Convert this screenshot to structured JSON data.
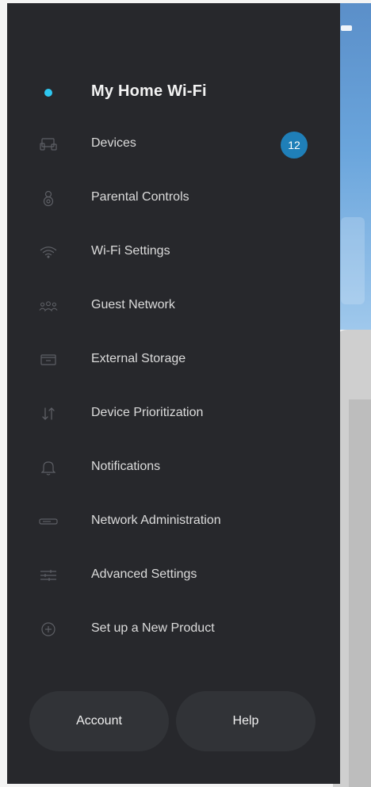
{
  "drawer": {
    "network_name": "My Home Wi-Fi",
    "status_color": "#2ec7f0",
    "items": [
      {
        "label": "Devices",
        "icon": "devices-icon",
        "badge": "12"
      },
      {
        "label": "Parental Controls",
        "icon": "parental-controls-icon"
      },
      {
        "label": "Wi-Fi Settings",
        "icon": "wifi-icon"
      },
      {
        "label": "Guest Network",
        "icon": "guests-icon"
      },
      {
        "label": "External Storage",
        "icon": "storage-icon"
      },
      {
        "label": "Device Prioritization",
        "icon": "prioritization-arrows-icon"
      },
      {
        "label": "Notifications",
        "icon": "bell-icon"
      },
      {
        "label": "Network Administration",
        "icon": "router-icon"
      },
      {
        "label": "Advanced Settings",
        "icon": "sliders-icon"
      },
      {
        "label": "Set up a New Product",
        "icon": "plus-circle-icon"
      }
    ],
    "account_label": "Account",
    "help_label": "Help",
    "badge_color": "#1f7fb8"
  }
}
